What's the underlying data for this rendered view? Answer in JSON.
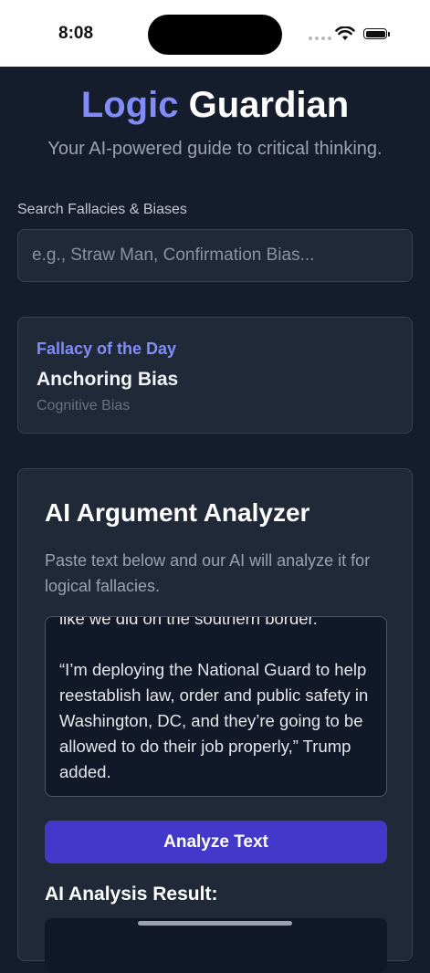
{
  "status_bar": {
    "time": "8:08"
  },
  "header": {
    "title_accent": "Logic",
    "title_rest": " Guardian",
    "subtitle": "Your AI-powered guide to critical thinking."
  },
  "search": {
    "label": "Search Fallacies & Biases",
    "placeholder": "e.g., Straw Man, Confirmation Bias..."
  },
  "fallacy_of_the_day": {
    "heading": "Fallacy of the Day",
    "name": "Anchoring Bias",
    "category": "Cognitive Bias"
  },
  "analyzer": {
    "title": "AI Argument Analyzer",
    "description": "Paste text below and our AI will analyze it for logical fallacies.",
    "text_value": "like we did on the southern border.\n\n“I’m deploying the National Guard to help reestablish law, order and public safety in Washington, DC, and they’re going to be allowed to do their job properly,” Trump added.",
    "button_label": "Analyze Text",
    "result_heading": "AI Analysis Result:"
  },
  "colors": {
    "background": "#151c2b",
    "card": "#1f2937",
    "accent": "#818cf8",
    "button": "#4338ca"
  }
}
